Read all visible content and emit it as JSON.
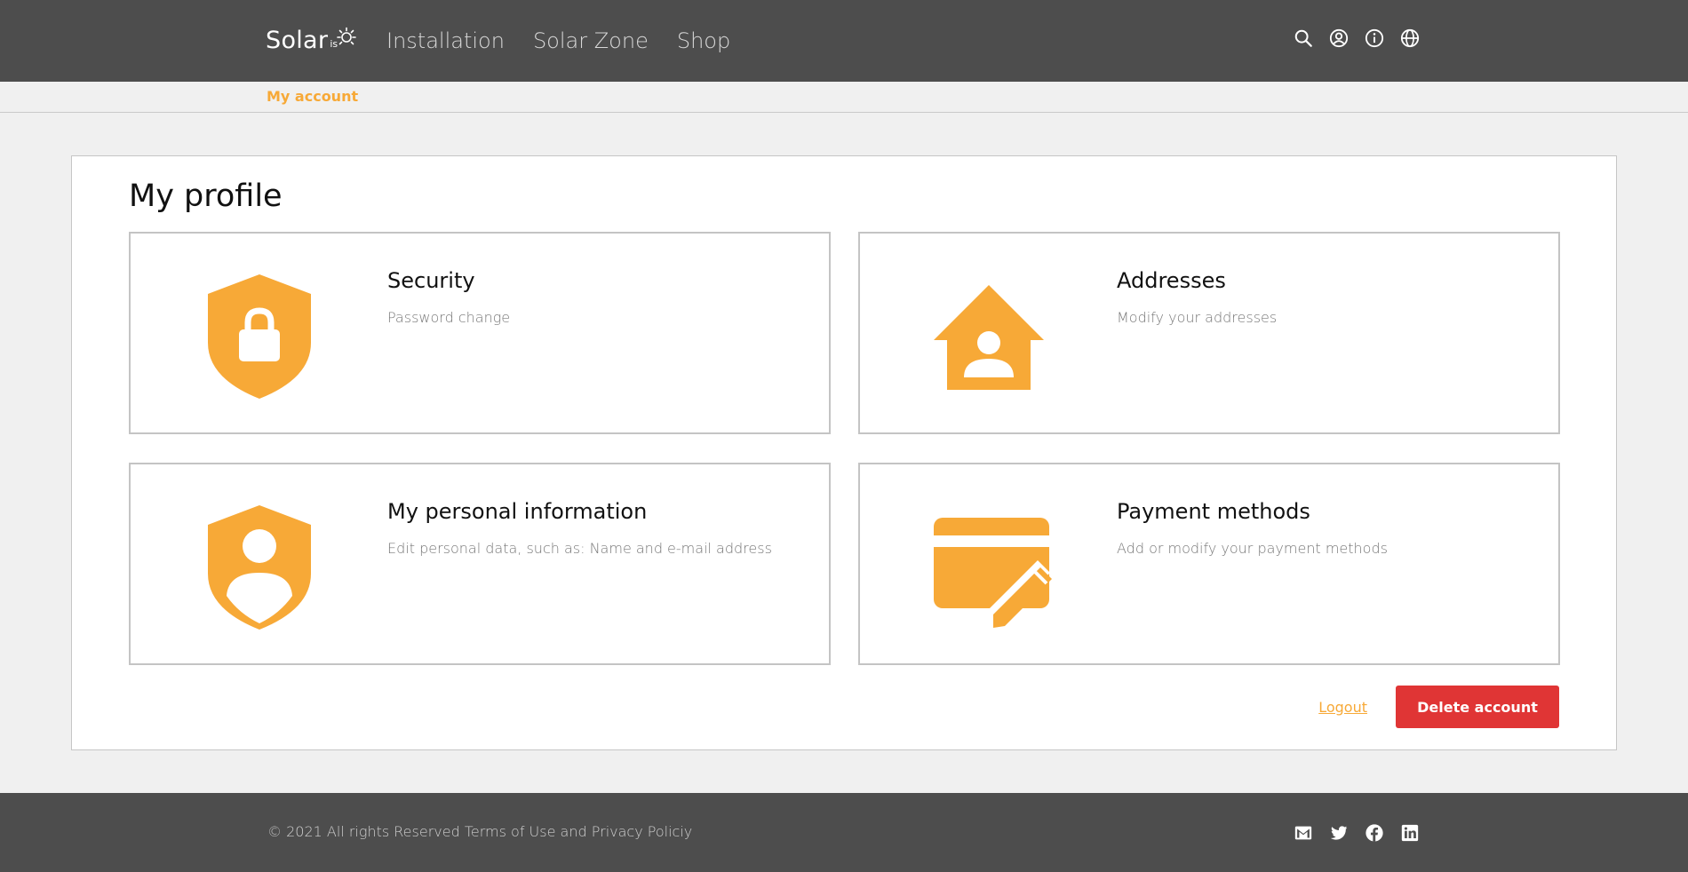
{
  "header": {
    "logo_text": "Solar",
    "logo_suffix": "is",
    "nav": [
      {
        "label": "Installation"
      },
      {
        "label": "Solar Zone"
      },
      {
        "label": "Shop"
      }
    ],
    "icons": [
      "search-icon",
      "user-circle-icon",
      "info-icon",
      "globe-icon"
    ]
  },
  "breadcrumb": {
    "label": "My account"
  },
  "main": {
    "title": "My profile",
    "tiles": [
      {
        "title": "Security",
        "description": "Password change",
        "icon": "shield-lock-icon"
      },
      {
        "title": "Addresses",
        "description": "Modify your addresses",
        "icon": "house-person-icon"
      },
      {
        "title": "My personal information",
        "description": "Edit personal data, such as: Name and e-mail address",
        "icon": "shield-person-icon"
      },
      {
        "title": "Payment methods",
        "description": "Add or modify your payment methods",
        "icon": "card-edit-icon"
      }
    ],
    "logout_label": "Logout",
    "delete_label": "Delete account"
  },
  "footer": {
    "copyright": "© 2021 All rights Reserved",
    "terms": "Terms of Use",
    "and": "and",
    "privacy": "Privacy Policiy",
    "social": [
      "mail-icon",
      "twitter-icon",
      "facebook-icon",
      "linkedin-icon"
    ]
  },
  "colors": {
    "header_bg": "#4d4d4d",
    "accent": "#f7a937",
    "danger": "#e03535",
    "page_bg": "#f0f0f0"
  }
}
